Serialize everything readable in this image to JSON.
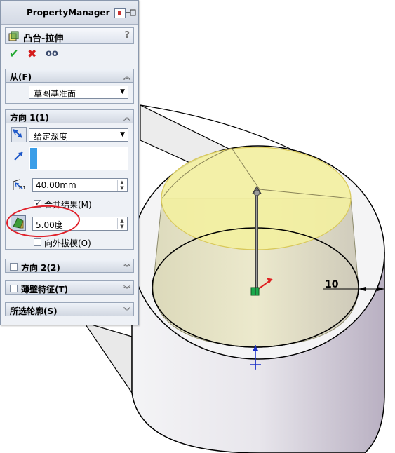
{
  "property_manager": {
    "title": "PropertyManager",
    "feature_name": "凸台-拉伸",
    "help": "?",
    "actions": {
      "ok_icon": "check-icon",
      "cancel_icon": "x-icon",
      "preview_icon": "glasses-icon"
    },
    "from": {
      "title": "从(F)",
      "select_value": "草图基准面"
    },
    "direction1": {
      "title": "方向 1(1)",
      "end_condition": "给定深度",
      "depth_value": "40.00mm",
      "depth_label": "D1",
      "merge_checked": true,
      "merge_label": "合并结果(M)",
      "draft_value": "5.00度",
      "draft_outward_checked": false,
      "draft_outward_label": "向外拔模(O)"
    },
    "direction2": {
      "title": "方向 2(2)",
      "checked": false
    },
    "thin": {
      "title": "薄壁特征(T)",
      "checked": false
    },
    "selected_contours": {
      "title": "所选轮廓(S)"
    }
  },
  "model": {
    "dimension_text": "10",
    "colors": {
      "preview": "#f3f0a0",
      "edge": "#000000",
      "body": "#d9d9dd"
    }
  }
}
